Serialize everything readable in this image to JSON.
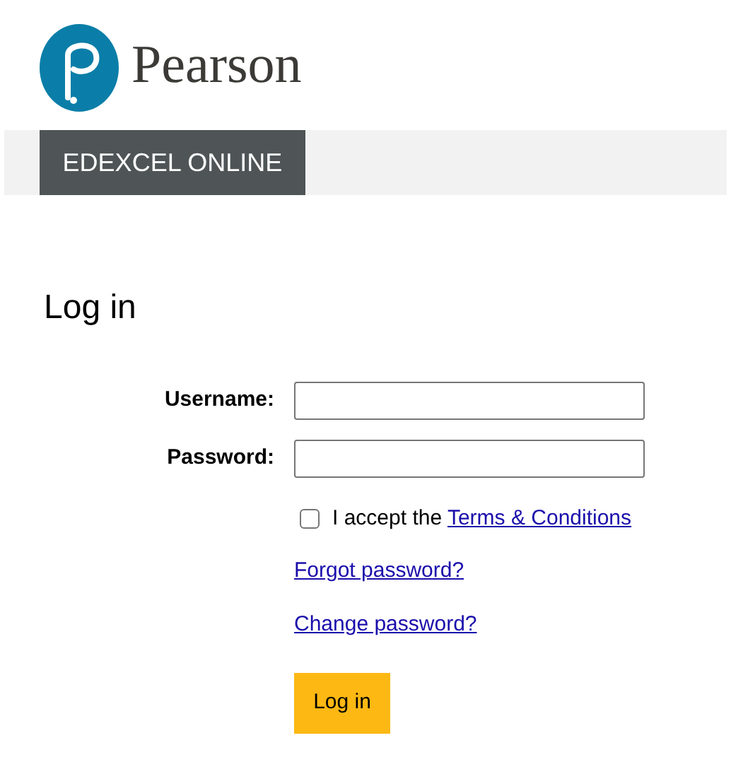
{
  "logo": {
    "text": "Pearson"
  },
  "nav": {
    "tabs": [
      {
        "label": "EDEXCEL ONLINE",
        "selected": true
      }
    ]
  },
  "heading": "Log in",
  "fields": [
    {
      "label": "Username:"
    },
    {
      "label": "Password:"
    }
  ],
  "terms": {
    "checked": false,
    "text": "I accept the",
    "link": "Terms & Conditions"
  },
  "links": [
    "Forgot password?",
    "Change password?"
  ],
  "button": "Log in"
}
